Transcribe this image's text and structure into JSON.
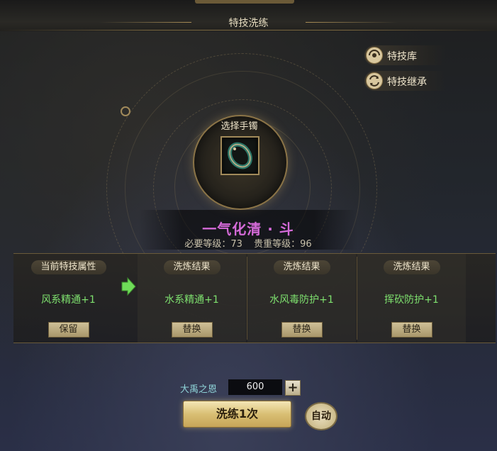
{
  "window": {
    "title": "特技洗练"
  },
  "side_menu": [
    {
      "label": "特技库",
      "icon": "skill-library-icon"
    },
    {
      "label": "特技继承",
      "icon": "inherit-icon"
    }
  ],
  "slot": {
    "label": "选择手镯",
    "item_icon": "bracelet-icon"
  },
  "skill": {
    "name": "一气化清 · 斗",
    "required_level": "必要等级：73",
    "noble_level": "贵重等级：96",
    "name_color": "#d46ad8"
  },
  "current": {
    "header": "当前特技属性",
    "value": "风系精通+1",
    "button": "保留"
  },
  "results": [
    {
      "header": "洗炼结果",
      "value": "水系精通+1",
      "button": "替换"
    },
    {
      "header": "洗炼结果",
      "value": "水风毒防护+1",
      "button": "替换"
    },
    {
      "header": "洗炼结果",
      "value": "挥砍防护+1",
      "button": "替换"
    }
  ],
  "cost": {
    "label": "大禹之恩",
    "value": "600",
    "plus_icon": "plus-icon"
  },
  "actions": {
    "wash": "洗练1次",
    "auto": "自动"
  },
  "colors": {
    "accent_gold": "#d9bf74",
    "value_green": "#7ee06e",
    "cost_cyan": "#8fd4d8"
  }
}
